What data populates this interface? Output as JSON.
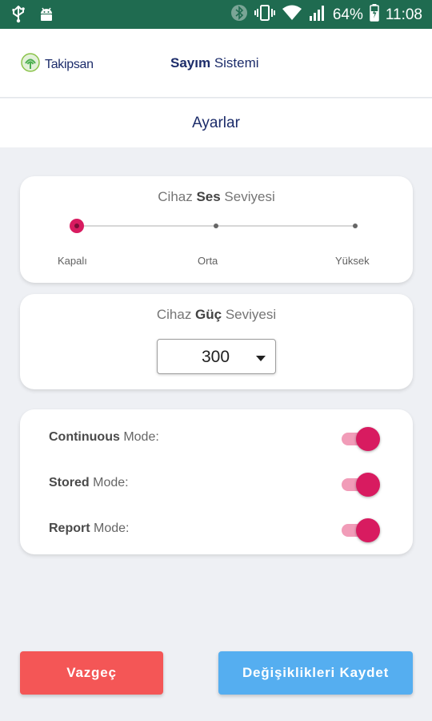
{
  "status_bar": {
    "battery_percent": "64%",
    "time": "11:08",
    "icons": [
      "usb-icon",
      "android-icon",
      "bluetooth-icon",
      "vibrate-icon",
      "wifi-icon",
      "signal-icon",
      "battery-icon"
    ]
  },
  "app_bar": {
    "logo_text": "Takipsan",
    "title_bold": "Sayım",
    "title_rest": " Sistemi"
  },
  "page": {
    "title": "Ayarlar"
  },
  "sound_card": {
    "title_pre": "Cihaz ",
    "title_bold": "Ses",
    "title_post": " Seviyesi",
    "levels": [
      "Kapalı",
      "Orta",
      "Yüksek"
    ],
    "selected_level": "Kapalı"
  },
  "power_card": {
    "title_pre": "Cihaz ",
    "title_bold": "Güç",
    "title_post": " Seviyesi",
    "selected_value": "300"
  },
  "modes_card": {
    "rows": [
      {
        "bold": "Continuous",
        "rest": " Mode:",
        "enabled": true
      },
      {
        "bold": "Stored",
        "rest": " Mode:",
        "enabled": true
      },
      {
        "bold": "Report",
        "rest": " Mode:",
        "enabled": true
      }
    ]
  },
  "buttons": {
    "cancel_label": "Vazgeç",
    "save_label": "Değişiklikleri Kaydet"
  },
  "colors": {
    "status_bar": "#1f6b50",
    "accent": "#d81b60",
    "cancel": "#f45656",
    "save": "#55aef0",
    "title_text": "#1c2c6a"
  }
}
